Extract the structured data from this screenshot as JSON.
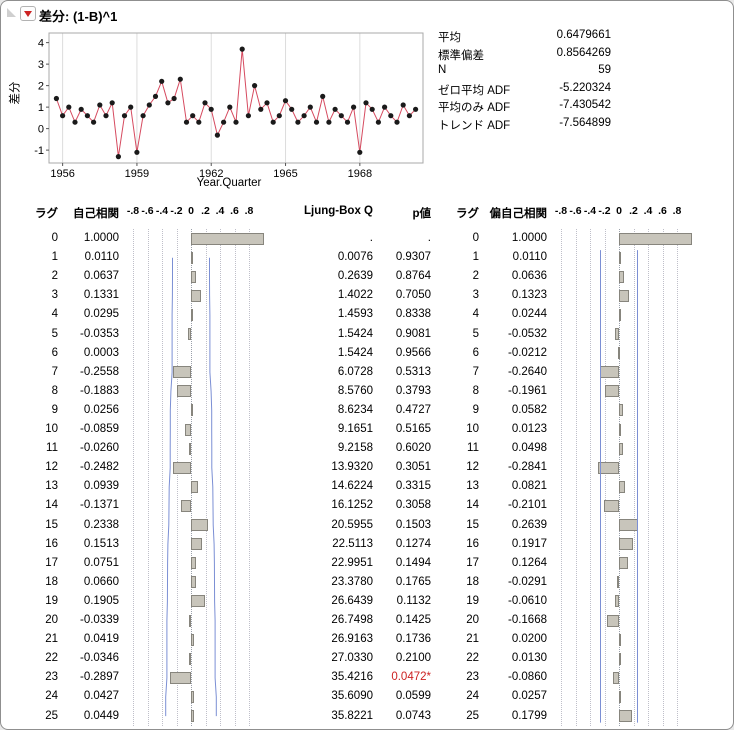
{
  "window": {
    "title": "差分: (1-B)^1"
  },
  "stats": {
    "rows": [
      {
        "label": "平均",
        "value": "0.6479661"
      },
      {
        "label": "標準偏差",
        "value": "0.8564269"
      },
      {
        "label": "N",
        "value": "59"
      },
      {
        "label": "ゼロ平均 ADF",
        "value": "-5.220324"
      },
      {
        "label": "平均のみ ADF",
        "value": "-7.430542"
      },
      {
        "label": "トレンド ADF",
        "value": "-7.564899"
      }
    ]
  },
  "corr": {
    "n": 59,
    "headers": {
      "lag": "ラグ",
      "acf": "自己相関",
      "ljung": "Ljung-Box Q",
      "pvalue": "p値",
      "lag2": "ラグ",
      "pacf": "偏自己相関"
    },
    "axis_ticks": [
      "-.8",
      "-.6",
      "-.4",
      "-.2",
      "0",
      ".2",
      ".4",
      ".6",
      ".8"
    ],
    "axis_tick_values": [
      -0.8,
      -0.6,
      -0.4,
      -0.2,
      0,
      0.2,
      0.4,
      0.6,
      0.8
    ],
    "rows": [
      {
        "lag": "0",
        "acf": "1.0000",
        "q": ".",
        "p": ".",
        "pacf": "1.0000",
        "sig": false
      },
      {
        "lag": "1",
        "acf": "0.0110",
        "q": "0.0076",
        "p": "0.9307",
        "pacf": "0.0110",
        "sig": false
      },
      {
        "lag": "2",
        "acf": "0.0637",
        "q": "0.2639",
        "p": "0.8764",
        "pacf": "0.0636",
        "sig": false
      },
      {
        "lag": "3",
        "acf": "0.1331",
        "q": "1.4022",
        "p": "0.7050",
        "pacf": "0.1323",
        "sig": false
      },
      {
        "lag": "4",
        "acf": "0.0295",
        "q": "1.4593",
        "p": "0.8338",
        "pacf": "0.0244",
        "sig": false
      },
      {
        "lag": "5",
        "acf": "-0.0353",
        "q": "1.5424",
        "p": "0.9081",
        "pacf": "-0.0532",
        "sig": false
      },
      {
        "lag": "6",
        "acf": "0.0003",
        "q": "1.5424",
        "p": "0.9566",
        "pacf": "-0.0212",
        "sig": false
      },
      {
        "lag": "7",
        "acf": "-0.2558",
        "q": "6.0728",
        "p": "0.5313",
        "pacf": "-0.2640",
        "sig": false
      },
      {
        "lag": "8",
        "acf": "-0.1883",
        "q": "8.5760",
        "p": "0.3793",
        "pacf": "-0.1961",
        "sig": false
      },
      {
        "lag": "9",
        "acf": "0.0256",
        "q": "8.6234",
        "p": "0.4727",
        "pacf": "0.0582",
        "sig": false
      },
      {
        "lag": "10",
        "acf": "-0.0859",
        "q": "9.1651",
        "p": "0.5165",
        "pacf": "0.0123",
        "sig": false
      },
      {
        "lag": "11",
        "acf": "-0.0260",
        "q": "9.2158",
        "p": "0.6020",
        "pacf": "0.0498",
        "sig": false
      },
      {
        "lag": "12",
        "acf": "-0.2482",
        "q": "13.9320",
        "p": "0.3051",
        "pacf": "-0.2841",
        "sig": false
      },
      {
        "lag": "13",
        "acf": "0.0939",
        "q": "14.6224",
        "p": "0.3315",
        "pacf": "0.0821",
        "sig": false
      },
      {
        "lag": "14",
        "acf": "-0.1371",
        "q": "16.1252",
        "p": "0.3058",
        "pacf": "-0.2101",
        "sig": false
      },
      {
        "lag": "15",
        "acf": "0.2338",
        "q": "20.5955",
        "p": "0.1503",
        "pacf": "0.2639",
        "sig": false
      },
      {
        "lag": "16",
        "acf": "0.1513",
        "q": "22.5113",
        "p": "0.1274",
        "pacf": "0.1917",
        "sig": false
      },
      {
        "lag": "17",
        "acf": "0.0751",
        "q": "22.9951",
        "p": "0.1494",
        "pacf": "0.1264",
        "sig": false
      },
      {
        "lag": "18",
        "acf": "0.0660",
        "q": "23.3780",
        "p": "0.1765",
        "pacf": "-0.0291",
        "sig": false
      },
      {
        "lag": "19",
        "acf": "0.1905",
        "q": "26.6439",
        "p": "0.1132",
        "pacf": "-0.0610",
        "sig": false
      },
      {
        "lag": "20",
        "acf": "-0.0339",
        "q": "26.7498",
        "p": "0.1425",
        "pacf": "-0.1668",
        "sig": false
      },
      {
        "lag": "21",
        "acf": "0.0419",
        "q": "26.9163",
        "p": "0.1736",
        "pacf": "0.0200",
        "sig": false
      },
      {
        "lag": "22",
        "acf": "-0.0346",
        "q": "27.0330",
        "p": "0.2100",
        "pacf": "0.0130",
        "sig": false
      },
      {
        "lag": "23",
        "acf": "-0.2897",
        "q": "35.4216",
        "p": "0.0472*",
        "pacf": "-0.0860",
        "sig": true
      },
      {
        "lag": "24",
        "acf": "0.0427",
        "q": "35.6090",
        "p": "0.0599",
        "pacf": "0.0257",
        "sig": false
      },
      {
        "lag": "25",
        "acf": "0.0449",
        "q": "35.8221",
        "p": "0.0743",
        "pacf": "0.1799",
        "sig": false
      }
    ]
  },
  "chart_data": [
    {
      "type": "line",
      "title": "差分: (1-B)^1 time series",
      "xlabel": "Year.Quarter",
      "ylabel": "差分",
      "x_start": 1955.75,
      "x_step": 0.25,
      "xlim": [
        1955.45,
        1970.55
      ],
      "ylim": [
        -1.6,
        4.45
      ],
      "xticks": [
        1956,
        1959,
        1962,
        1965,
        1968
      ],
      "yticks": [
        -1,
        0,
        1,
        2,
        3,
        4
      ],
      "line_color": "#d64a5f",
      "marker_color": "#1a1a1a",
      "grid": "vertical-only",
      "values": [
        1.4,
        0.6,
        1.0,
        0.3,
        0.9,
        0.6,
        0.3,
        1.1,
        0.6,
        1.2,
        -1.3,
        0.6,
        1.0,
        -1.1,
        0.6,
        1.1,
        1.5,
        2.2,
        1.2,
        1.4,
        2.3,
        0.3,
        0.6,
        0.3,
        1.2,
        0.9,
        -0.3,
        0.3,
        1.0,
        0.3,
        3.7,
        0.6,
        2.0,
        0.9,
        1.2,
        0.3,
        0.6,
        1.3,
        0.9,
        0.3,
        0.6,
        1.0,
        0.3,
        1.5,
        0.3,
        0.9,
        0.6,
        0.3,
        1.0,
        -1.1,
        1.2,
        0.9,
        0.3,
        1.0,
        0.6,
        0.3,
        1.1,
        0.6,
        0.9
      ]
    },
    {
      "type": "bar",
      "orientation": "horizontal",
      "title": "自己相関 (ACF)",
      "xlim": [
        -1,
        1
      ],
      "ticks": [
        -0.8,
        -0.6,
        -0.4,
        -0.2,
        0,
        0.2,
        0.4,
        0.6,
        0.8
      ],
      "lags": [
        0,
        1,
        2,
        3,
        4,
        5,
        6,
        7,
        8,
        9,
        10,
        11,
        12,
        13,
        14,
        15,
        16,
        17,
        18,
        19,
        20,
        21,
        22,
        23,
        24,
        25
      ],
      "values": [
        1.0,
        0.011,
        0.0637,
        0.1331,
        0.0295,
        -0.0353,
        0.0003,
        -0.2558,
        -0.1883,
        0.0256,
        -0.0859,
        -0.026,
        -0.2482,
        0.0939,
        -0.1371,
        0.2338,
        0.1513,
        0.0751,
        0.066,
        0.1905,
        -0.0339,
        0.0419,
        -0.0346,
        -0.2897,
        0.0427,
        0.0449
      ],
      "bar_color": "#c8c5bb",
      "conf_color": "#7b8fd4",
      "conf": "widening"
    },
    {
      "type": "bar",
      "orientation": "horizontal",
      "title": "偏自己相関 (PACF)",
      "xlim": [
        -1,
        1
      ],
      "ticks": [
        -0.8,
        -0.6,
        -0.4,
        -0.2,
        0,
        0.2,
        0.4,
        0.6,
        0.8
      ],
      "lags": [
        0,
        1,
        2,
        3,
        4,
        5,
        6,
        7,
        8,
        9,
        10,
        11,
        12,
        13,
        14,
        15,
        16,
        17,
        18,
        19,
        20,
        21,
        22,
        23,
        24,
        25
      ],
      "values": [
        1.0,
        0.011,
        0.0636,
        0.1323,
        0.0244,
        -0.0532,
        -0.0212,
        -0.264,
        -0.1961,
        0.0582,
        0.0123,
        0.0498,
        -0.2841,
        0.0821,
        -0.2101,
        0.2639,
        0.1917,
        0.1264,
        -0.0291,
        -0.061,
        -0.1668,
        0.02,
        0.013,
        -0.086,
        0.0257,
        0.1799
      ],
      "bar_color": "#c8c5bb",
      "conf_color": "#7b8fd4",
      "conf": "fixed"
    }
  ]
}
